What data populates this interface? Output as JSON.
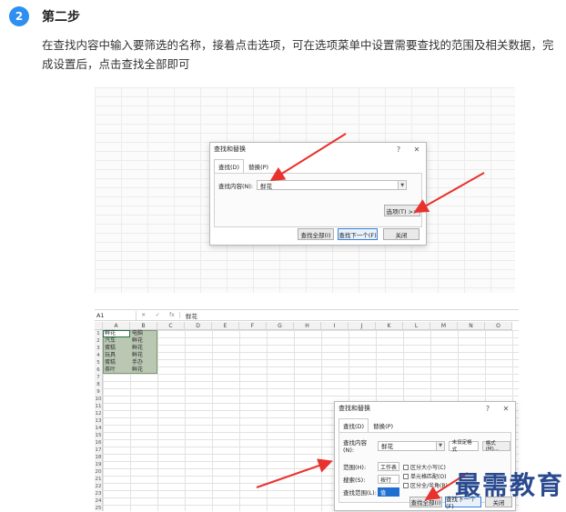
{
  "step": {
    "number": "2",
    "title": "第二步",
    "desc_line1": "在查找内容中输入要筛选的名称，接着点击选项，可在选项菜单中设置需要查找的范围及相关数据，完",
    "desc_line2": "成设置后，点击查找全部即可"
  },
  "dialog1": {
    "title": "查找和替换",
    "help": "?",
    "close": "✕",
    "tabs": [
      {
        "label": "查找(D)",
        "active": true
      },
      {
        "label": "替换(P)",
        "active": false
      }
    ],
    "find_label": "查找内容(N):",
    "find_value": "鲜花",
    "options_button": "选项(T) >>",
    "find_all_button": "查找全部(I)",
    "find_next_button": "查找下一个(F)",
    "close_button": "关闭"
  },
  "sheet": {
    "name_box": "A1",
    "fx_cancel": "✕",
    "fx_enter": "✓",
    "fx_label": "fx",
    "formula_value": "鲜花",
    "columns": [
      "A",
      "B",
      "C",
      "D",
      "E",
      "F",
      "G",
      "H",
      "I",
      "J",
      "K",
      "L",
      "M",
      "N",
      "O"
    ],
    "rows": [
      "1",
      "2",
      "3",
      "4",
      "5",
      "6",
      "7",
      "8",
      "9",
      "10",
      "11",
      "12",
      "13",
      "14",
      "15",
      "16",
      "17",
      "18",
      "19",
      "20",
      "21",
      "22",
      "23",
      "24",
      "25"
    ],
    "cells": [
      [
        "鲜花",
        "电脑"
      ],
      [
        "汽车",
        "鲜花"
      ],
      [
        "蛋糕",
        "鲜花"
      ],
      [
        "玩具",
        "鲜花"
      ],
      [
        "蛋糕",
        "手办"
      ],
      [
        "茶叶",
        "鲜花"
      ]
    ]
  },
  "dialog2": {
    "title": "查找和替换",
    "help": "?",
    "close": "✕",
    "tabs": [
      {
        "label": "查找(D)",
        "active": true
      },
      {
        "label": "替换(P)",
        "active": false
      }
    ],
    "find_label": "查找内容(N):",
    "find_value": "鲜花",
    "format_status": "未设定格式",
    "format_button": "格式(M)...",
    "scope_label": "范围(H):",
    "scope_value": "工作表",
    "search_label": "搜索(S):",
    "search_value": "按行",
    "lookin_label": "查找范围(L):",
    "lookin_value": "值",
    "checkboxes": [
      "区分大小写(C)",
      "单元格匹配(O)",
      "区分全/半角(B)"
    ],
    "find_all_button": "查找全部(I)",
    "find_next_button": "查找下一个(F)",
    "close_button": "关闭"
  },
  "watermark": "最需教育",
  "colors": {
    "badge": "#2d8ff0",
    "arrow": "#e8322d",
    "watermark": "#2a4a8f"
  }
}
